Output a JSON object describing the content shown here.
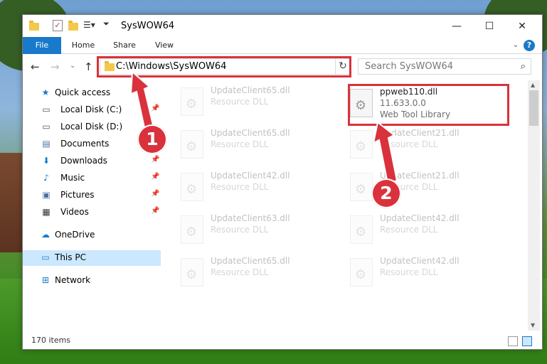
{
  "window": {
    "title": "SysWOW64",
    "buttons": {
      "minimize": "—",
      "maximize": "☐",
      "close": "✕"
    }
  },
  "ribbon": {
    "tabs": [
      "File",
      "Home",
      "Share",
      "View"
    ],
    "help": "?"
  },
  "address_bar": {
    "path": "C:\\Windows\\SysWOW64",
    "dropdown": "⌄",
    "refresh": "↻"
  },
  "search": {
    "placeholder": "Search SysWOW64"
  },
  "sidebar": {
    "quick_access": "Quick access",
    "items": [
      {
        "label": "Local Disk (C:)",
        "icon": "drive-icon",
        "pinned": true
      },
      {
        "label": "Local Disk (D:)",
        "icon": "drive-icon",
        "pinned": false
      },
      {
        "label": "Documents",
        "icon": "documents-icon",
        "pinned": true
      },
      {
        "label": "Downloads",
        "icon": "downloads-icon",
        "pinned": true
      },
      {
        "label": "Music",
        "icon": "music-icon",
        "pinned": true
      },
      {
        "label": "Pictures",
        "icon": "pictures-icon",
        "pinned": true
      },
      {
        "label": "Videos",
        "icon": "videos-icon",
        "pinned": true
      }
    ],
    "onedrive": "OneDrive",
    "this_pc": "This PC",
    "network": "Network"
  },
  "files": {
    "selected": {
      "name": "ppweb110.dll",
      "version": "11.633.0.0",
      "description": "Web Tool Library"
    },
    "left_column": [
      {
        "name": "UpdateClient65.dll",
        "type": "Resource DLL"
      },
      {
        "name": "UpdateClient65.dll",
        "type": "Resource DLL"
      },
      {
        "name": "UpdateClient42.dll",
        "type": "Resource DLL"
      },
      {
        "name": "UpdateClient63.dll",
        "type": "Resource DLL"
      },
      {
        "name": "UpdateClient65.dll",
        "type": "Resource DLL"
      }
    ],
    "right_column": [
      {
        "name": "UpdateClient21.dll",
        "type": "Resource DLL"
      },
      {
        "name": "UpdateClient21.dll",
        "type": "Resource DLL"
      },
      {
        "name": "UpdateClient42.dll",
        "type": "Resource DLL"
      },
      {
        "name": "UpdateClient42.dll",
        "type": "Resource DLL"
      }
    ]
  },
  "status": {
    "item_count": "170 items"
  },
  "callouts": [
    "1",
    "2"
  ],
  "colors": {
    "accent": "#1979ca",
    "highlight": "#d9323c",
    "selected_nav": "#cce8ff"
  }
}
